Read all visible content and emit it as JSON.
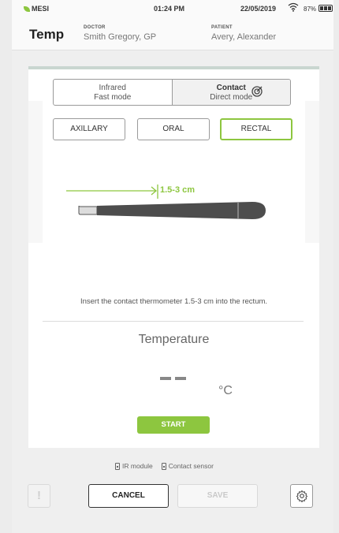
{
  "status_bar": {
    "brand": "MESI",
    "time": "01:24 PM",
    "date": "22/05/2019",
    "battery": "87%"
  },
  "header": {
    "title": "Temp",
    "doctor_label": "DOCTOR",
    "doctor_name": "Smith Gregory, GP",
    "patient_label": "PATIENT",
    "patient_name": "Avery, Alexander"
  },
  "mode": {
    "infrared_title": "Infrared",
    "infrared_sub": "Fast mode",
    "contact_title": "Contact",
    "contact_sub": "Direct mode",
    "selected": "contact"
  },
  "sites": {
    "axillary": "AXILLARY",
    "oral": "ORAL",
    "rectal": "RECTAL",
    "selected": "rectal"
  },
  "illustration": {
    "depth_label": "1.5-3 cm"
  },
  "instruction": "Insert the contact thermometer 1.5-3 cm into the rectum.",
  "measurement": {
    "label": "Temperature",
    "value": "- -",
    "unit": "°C"
  },
  "start_label": "START",
  "modules": {
    "ir": "IR module",
    "contact": "Contact sensor"
  },
  "actions": {
    "alert": "!",
    "cancel": "CANCEL",
    "save": "SAVE"
  },
  "colors": {
    "accent_green": "#8dc63f",
    "thermometer_body": "#4d4d4d"
  }
}
